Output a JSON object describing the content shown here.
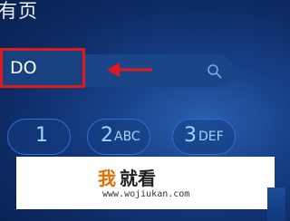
{
  "header": {
    "title": "有页"
  },
  "search": {
    "value": "DO",
    "icon": "search-icon"
  },
  "dialpad": {
    "keys": [
      {
        "num": "1",
        "letters": ""
      },
      {
        "num": "2",
        "letters": "ABC"
      },
      {
        "num": "3",
        "letters": "DEF"
      }
    ]
  },
  "watermark": {
    "logo": "我",
    "name": "就看",
    "url": "www.wojiukan.com"
  },
  "colors": {
    "highlight": "#e01a1a",
    "accent": "#9fd6ff",
    "watermark_logo": "#e66c00"
  }
}
